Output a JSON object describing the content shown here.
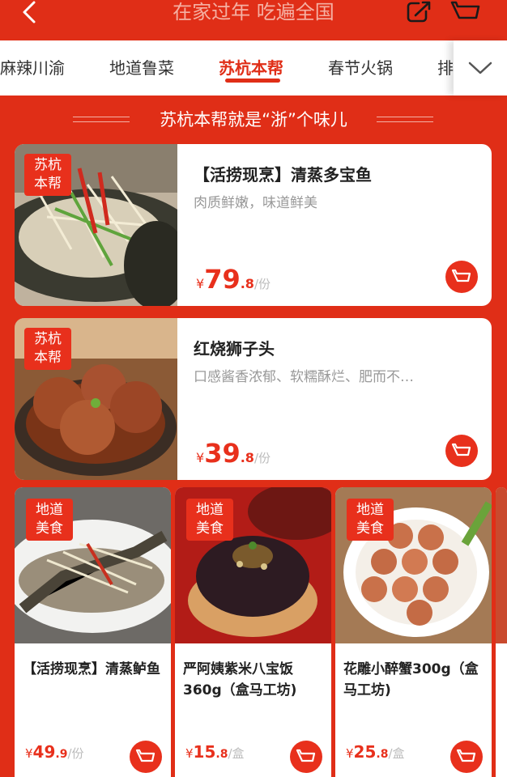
{
  "header": {
    "title": "在家过年 吃遍全国",
    "back_icon": "chevron-left-icon",
    "share_icon": "share-icon",
    "cart_icon": "cart-icon"
  },
  "tabs": [
    {
      "label": "麻辣川渝",
      "active": false
    },
    {
      "label": "地道鲁菜",
      "active": false
    },
    {
      "label": "苏杭本帮",
      "active": true
    },
    {
      "label": "春节火锅",
      "active": false
    },
    {
      "label": "排",
      "active": false
    }
  ],
  "section": {
    "title": "苏杭本帮就是“浙”个味儿"
  },
  "featured": [
    {
      "badge_line1": "苏杭",
      "badge_line2": "本帮",
      "title": "【活捞现烹】清蒸多宝鱼",
      "desc": "肉质鲜嫩，味道鲜美",
      "currency": "¥",
      "price_int": "79",
      "price_dec": ".8",
      "unit": "/份"
    },
    {
      "badge_line1": "苏杭",
      "badge_line2": "本帮",
      "title": "红烧狮子头",
      "desc": "口感酱香浓郁、软糯酥烂、肥而不…",
      "currency": "¥",
      "price_int": "39",
      "price_dec": ".8",
      "unit": "/份"
    }
  ],
  "grid": [
    {
      "badge_line1": "地道",
      "badge_line2": "美食",
      "title": "【活捞现烹】清蒸鲈鱼",
      "currency": "¥",
      "price_int": "49",
      "price_dec": ".9",
      "unit": "/份"
    },
    {
      "badge_line1": "地道",
      "badge_line2": "美食",
      "title": "严阿姨紫米八宝饭360g（盒马工坊)",
      "currency": "¥",
      "price_int": "15",
      "price_dec": ".8",
      "unit": "/盒"
    },
    {
      "badge_line1": "地道",
      "badge_line2": "美食",
      "title": "花雕小醉蟹300g（盒马工坊)",
      "currency": "¥",
      "price_int": "25",
      "price_dec": ".8",
      "unit": "/盒"
    }
  ],
  "colors": {
    "brand_red": "#e02e17",
    "price_red": "#e8301c",
    "muted_text": "#999999"
  }
}
